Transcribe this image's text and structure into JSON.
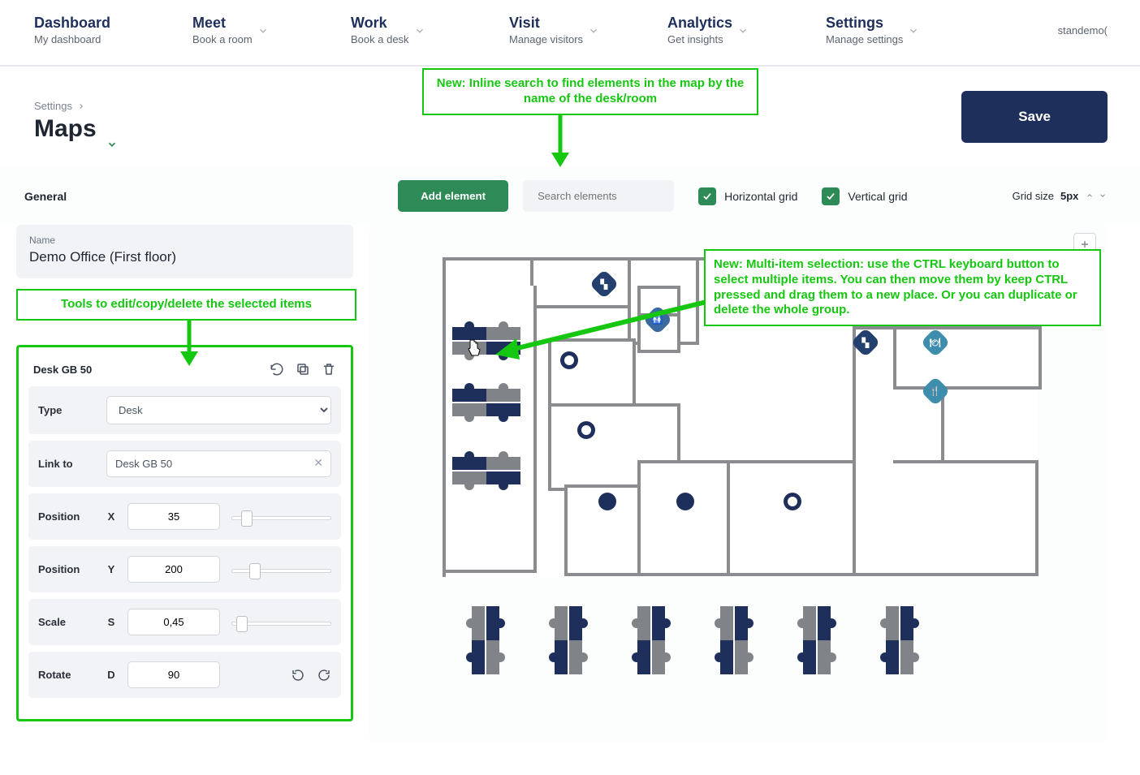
{
  "nav": {
    "items": [
      {
        "title": "Dashboard",
        "sub": "My dashboard"
      },
      {
        "title": "Meet",
        "sub": "Book a room"
      },
      {
        "title": "Work",
        "sub": "Book a desk"
      },
      {
        "title": "Visit",
        "sub": "Manage visitors"
      },
      {
        "title": "Analytics",
        "sub": "Get insights"
      },
      {
        "title": "Settings",
        "sub": "Manage settings"
      }
    ],
    "user": "standemo("
  },
  "breadcrumb": "Settings",
  "page_title": "Maps",
  "save_label": "Save",
  "callouts": {
    "search": "New: Inline search to find elements in the map by the name of the desk/room",
    "tools": "Tools to edit/copy/delete the selected items",
    "multi": "New: Multi-item selection: use the CTRL keyboard button to select multiple items. You can then move them by keep CTRL pressed and drag them to a new place. Or you can duplicate or delete the whole group."
  },
  "toolbar": {
    "general": "General",
    "add": "Add element",
    "search_placeholder": "Search elements",
    "hgrid": "Horizontal grid",
    "vgrid": "Vertical grid",
    "gridsize_label": "Grid size",
    "gridsize_value": "5px"
  },
  "name_card": {
    "label": "Name",
    "value": "Demo Office (First floor)"
  },
  "panel": {
    "item_name": "Desk GB 50",
    "type_label": "Type",
    "type_value": "Desk",
    "link_label": "Link to",
    "link_value": "Desk GB 50",
    "posx_label": "Position",
    "posx_axis": "X",
    "posx_value": "35",
    "posy_label": "Position",
    "posy_axis": "Y",
    "posy_value": "200",
    "scale_label": "Scale",
    "scale_axis": "S",
    "scale_value": "0,45",
    "rotate_label": "Rotate",
    "rotate_axis": "D",
    "rotate_value": "90"
  }
}
